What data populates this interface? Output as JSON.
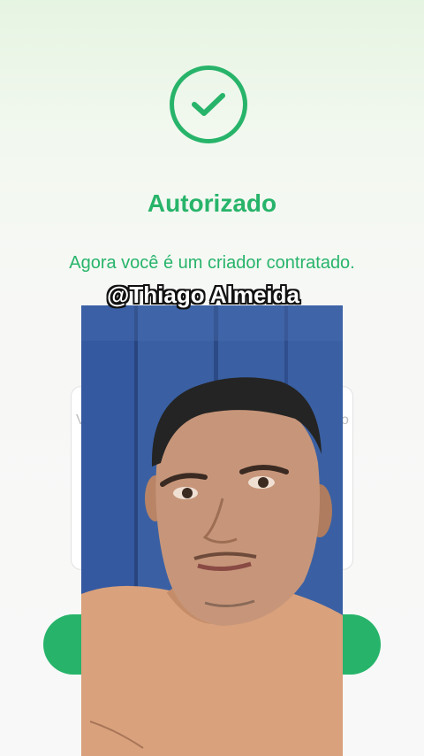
{
  "status": {
    "icon": "check-circle-icon",
    "title": "Autorizado",
    "message": "Agora você é um criador contratado.",
    "accent": "#27b46a"
  },
  "card": {
    "left_fragment": "V",
    "right_fragment": "o"
  },
  "overlay": {
    "handle": "@Thiago Almeida",
    "wall_color": "#3b62a6",
    "shirt_color": "#d8a07c"
  }
}
